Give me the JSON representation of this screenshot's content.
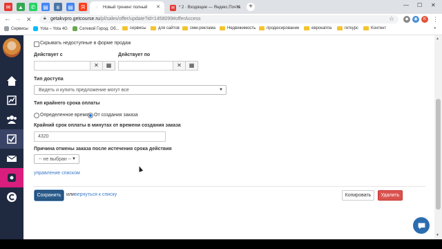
{
  "browser": {
    "tabs": [
      {
        "title": "Новый тренинг полный",
        "active": true
      },
      {
        "title": "* 2 · Входящие — Яндекс.Почта",
        "active": false
      }
    ],
    "url_host": "getakvpro.getcourse.ru",
    "url_path": "/pl/sales/offer/update?id=1458099#offerAccess",
    "bookmarks": [
      {
        "label": "Сервисы",
        "kind": "apps"
      },
      {
        "label": "Yota – Yota 4G",
        "kind": "site"
      },
      {
        "label": "Сетевой Город. Об...",
        "kind": "site"
      },
      {
        "label": "сервисы",
        "kind": "folder"
      },
      {
        "label": "для сайтов",
        "kind": "folder"
      },
      {
        "label": "смм-реклама",
        "kind": "folder"
      },
      {
        "label": "Недвижимость",
        "kind": "folder"
      },
      {
        "label": "продюсирование",
        "kind": "folder"
      },
      {
        "label": "еврокаппа",
        "kind": "folder"
      },
      {
        "label": "геткурс",
        "kind": "folder"
      },
      {
        "label": "Контент",
        "kind": "folder"
      }
    ],
    "profile_initial": "K"
  },
  "form": {
    "hide_unavailable_label": "Скрывать недоступные в форме продаж",
    "valid_from_label": "Действует с",
    "valid_to_label": "Действует по",
    "access_type_label": "Тип доступа",
    "access_type_value": "Видеть и купить предложение могут все",
    "deadline_type_label": "Тип крайнего срока оплаты",
    "deadline_option_fixed": "Определенное время",
    "deadline_option_from_order": "От создания заказа",
    "deadline_minutes_label": "Крайний срок оплаты в минутах от времени создания заказа",
    "deadline_minutes_value": "4320",
    "cancel_reason_label": "Причина отмены заказа после истечения срока действия",
    "cancel_reason_value": "-- не выбран --",
    "manage_list_link": "управление списком"
  },
  "actions": {
    "save": "Сохранить",
    "or_text": "или",
    "back_link": "вернуться к списку",
    "copy": "Копировать",
    "delete": "Удалить"
  }
}
